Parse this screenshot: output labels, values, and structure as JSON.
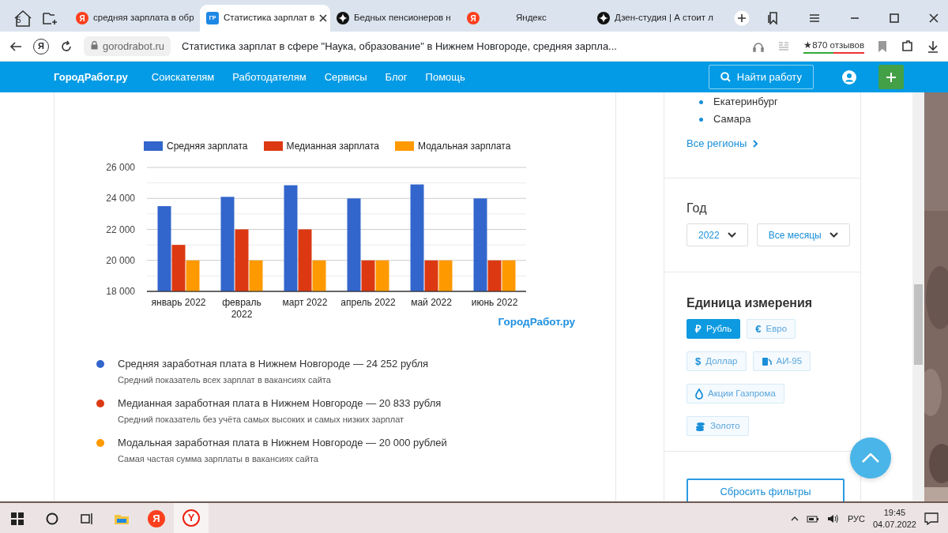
{
  "browser": {
    "home_badge": "5",
    "tabs": [
      {
        "title": "средняя зарплата в обр",
        "kind": "yandex",
        "favicon_text": "Я",
        "selected": false
      },
      {
        "title": "Статистика зарплат в",
        "kind": "site",
        "favicon_text": "ГР",
        "selected": true
      },
      {
        "title": "Бедных пенсионеров н",
        "kind": "zen",
        "selected": false
      },
      {
        "title": "Яндекс",
        "kind": "yandex",
        "favicon_text": "Я",
        "selected": false
      },
      {
        "title": "Дзен-студия | А стоит л",
        "kind": "zen",
        "selected": false
      }
    ],
    "address": {
      "yandex_button": "Я",
      "domain": "gorodrabot.ru",
      "title": "Статистика зарплат в сфере \"Наука, образование\" в Нижнем Новгороде, средняя зарпла...",
      "reviews": "★870 отзывов"
    }
  },
  "site_nav": {
    "brand": "ГородРабот.ру",
    "links": [
      "Соискателям",
      "Работодателям",
      "Сервисы",
      "Блог",
      "Помощь"
    ],
    "search_button": "Найти работу"
  },
  "chart": {
    "chart_data": {
      "type": "bar",
      "categories": [
        "январь 2022",
        "февраль 2022",
        "март 2022",
        "апрель 2022",
        "май 2022",
        "июнь 2022"
      ],
      "series": [
        {
          "name": "Средняя зарплата",
          "color": "#3366cc",
          "values": [
            23500,
            24100,
            24850,
            24000,
            24900,
            24000
          ]
        },
        {
          "name": "Медианная зарплата",
          "color": "#dc3912",
          "values": [
            21000,
            22000,
            22000,
            20000,
            20000,
            20000
          ]
        },
        {
          "name": "Модальная зарплата",
          "color": "#ff9900",
          "values": [
            20000,
            20000,
            20000,
            20000,
            20000,
            20000
          ]
        }
      ],
      "ylim": [
        18000,
        26000
      ],
      "grid": true,
      "legend": "top",
      "yticks": [
        {
          "value": 18000,
          "label": "18 000"
        },
        {
          "value": 20000,
          "label": "20 000"
        },
        {
          "value": 22000,
          "label": "22 000"
        },
        {
          "value": 24000,
          "label": "24 000"
        },
        {
          "value": 26000,
          "label": "26 000"
        }
      ]
    },
    "brand_caption": "ГородРабот.ру"
  },
  "stats": [
    {
      "color": "#3366cc",
      "title": "Средняя заработная плата в Нижнем Новгороде — 24 252 рубля",
      "subtitle": "Средний показатель всех зарплат в вакансиях сайта"
    },
    {
      "color": "#dc3912",
      "title": "Медианная заработная плата в Нижнем Новгороде — 20 833 рубля",
      "subtitle": "Средний показатель без учёта самых высоких и самых низких зарплат"
    },
    {
      "color": "#ff9900",
      "title": "Модальная заработная плата в Нижнем Новгороде — 20 000 рублей",
      "subtitle": "Самая частая сумма зарплаты в вакансиях сайта"
    }
  ],
  "sidebar": {
    "regions": [
      "Екатеринбург",
      "Самара"
    ],
    "all_regions_link": "Все регионы",
    "year": {
      "heading": "Год",
      "selects": [
        "2022",
        "Все месяцы"
      ]
    },
    "units": {
      "heading": "Единица измерения",
      "items": [
        {
          "label": "Рубль",
          "kind": "symbol",
          "symbol": "₽",
          "selected": true
        },
        {
          "label": "Евро",
          "kind": "symbol",
          "symbol": "€",
          "selected": false
        },
        {
          "label": "Доллар",
          "kind": "symbol",
          "symbol": "$",
          "selected": false
        },
        {
          "label": "АИ-95",
          "kind": "fuel",
          "selected": false
        },
        {
          "label": "Акции Газпрома",
          "kind": "drop",
          "selected": false
        },
        {
          "label": "Золото",
          "kind": "coins",
          "selected": false
        }
      ]
    },
    "reset_button": "Сбросить фильтры"
  },
  "taskbar": {
    "apps": [
      {
        "kind": "start",
        "selected": false
      },
      {
        "kind": "search",
        "selected": false
      },
      {
        "kind": "taskview",
        "selected": false
      },
      {
        "kind": "explorer",
        "selected": false
      },
      {
        "kind": "yandex",
        "text": "Я",
        "selected": false
      },
      {
        "kind": "ybrowser",
        "text": "Y",
        "selected": true
      }
    ],
    "language": "РУС",
    "time": "19:45",
    "date": "04.07.2022"
  }
}
